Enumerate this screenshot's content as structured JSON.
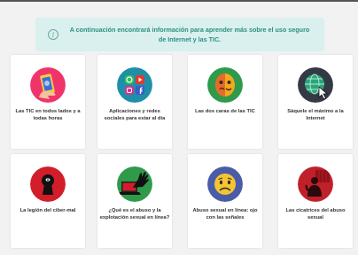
{
  "banner": {
    "text": "A continuación encontrará información para aprender más sobre el uso seguro de Internet y las TIC."
  },
  "cards": [
    {
      "label": "Las TIC en todos lados y a todas horas",
      "icon": "phone-hand-icon"
    },
    {
      "label": "Aplicaciones y redes sociales para estar al día",
      "icon": "social-apps-icon"
    },
    {
      "label": "Las dos caras de las TIC",
      "icon": "masks-icon"
    },
    {
      "label": "Sáquele el máximo a la Internet",
      "icon": "globe-cursor-icon"
    },
    {
      "label": "La legión del ciber-mal",
      "icon": "keyhole-icon"
    },
    {
      "label": "¿Qué es el abuso y la explotación sexual en línea?",
      "icon": "laptop-hand-icon"
    },
    {
      "label": "Abuso sexual en línea: ojo con las señales",
      "icon": "sad-face-icon"
    },
    {
      "label": "Las cicatrices del abuso sexual",
      "icon": "shadow-figure-icon"
    }
  ],
  "colors": {
    "banner_bg": "#d9f0ee",
    "banner_text": "#2d8f82",
    "card1": "#f0346a",
    "card2": "#1e8fa8",
    "card3": "#2e9a4a",
    "card4": "#1e8fa8",
    "card5": "#d21e2a",
    "card6": "#2e9a4a",
    "card7": "#4a5ca8",
    "card8": "#c0202a"
  }
}
